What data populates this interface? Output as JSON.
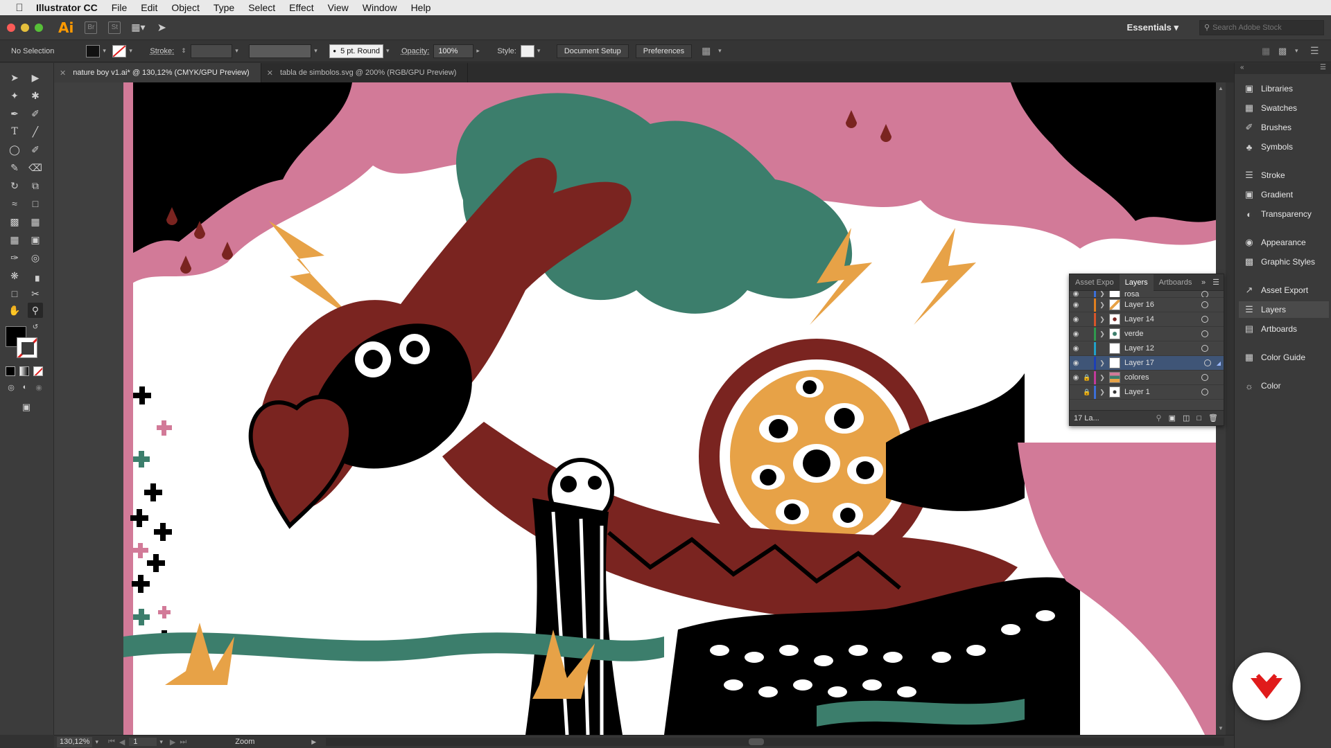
{
  "menubar": {
    "app_name": "Illustrator CC",
    "items": [
      "File",
      "Edit",
      "Object",
      "Type",
      "Select",
      "Effect",
      "View",
      "Window",
      "Help"
    ]
  },
  "appbar": {
    "logo": "Ai",
    "bridge_icon": "Br",
    "stock_icon": "St",
    "workspace": "Essentials",
    "search_placeholder": "Search Adobe Stock"
  },
  "controlbar": {
    "selection": "No Selection",
    "stroke_label": "Stroke:",
    "brush": "5 pt. Round",
    "opacity_label": "Opacity:",
    "opacity": "100%",
    "style_label": "Style:",
    "document_setup": "Document Setup",
    "preferences": "Preferences"
  },
  "tabs": [
    {
      "label": "nature boy v1.ai* @ 130,12% (CMYK/GPU Preview)",
      "active": true
    },
    {
      "label": "tabla de simbolos.svg @ 200% (RGB/GPU Preview)",
      "active": false
    }
  ],
  "dock": {
    "items": [
      {
        "label": "Libraries",
        "icon": "libraries-icon"
      },
      {
        "label": "Swatches",
        "icon": "swatches-icon"
      },
      {
        "label": "Brushes",
        "icon": "brushes-icon"
      },
      {
        "label": "Symbols",
        "icon": "symbols-icon"
      },
      {
        "label": "Stroke",
        "icon": "stroke-icon"
      },
      {
        "label": "Gradient",
        "icon": "gradient-icon"
      },
      {
        "label": "Transparency",
        "icon": "transparency-icon"
      },
      {
        "label": "Appearance",
        "icon": "appearance-icon"
      },
      {
        "label": "Graphic Styles",
        "icon": "graphic-styles-icon"
      },
      {
        "label": "Asset Export",
        "icon": "asset-export-icon"
      },
      {
        "label": "Layers",
        "icon": "layers-icon"
      },
      {
        "label": "Artboards",
        "icon": "artboards-icon"
      },
      {
        "label": "Color Guide",
        "icon": "color-guide-icon"
      },
      {
        "label": "Color",
        "icon": "color-icon"
      }
    ]
  },
  "layers_panel": {
    "tabs": [
      "Asset Expo",
      "Layers",
      "Artboards"
    ],
    "active_tab": "Layers",
    "rows": [
      {
        "name": "rosa",
        "color": "#3c6fd8",
        "visible": true,
        "locked": false
      },
      {
        "name": "Layer 16",
        "color": "#e0801e",
        "visible": true,
        "locked": false
      },
      {
        "name": "Layer 14",
        "color": "#d8552a",
        "visible": true,
        "locked": false
      },
      {
        "name": "verde",
        "color": "#2f9a4e",
        "visible": true,
        "locked": false
      },
      {
        "name": "Layer 12",
        "color": "#21a0c8",
        "visible": true,
        "locked": false
      },
      {
        "name": "Layer 17",
        "color": "#1c3fb8",
        "visible": true,
        "locked": false,
        "selected": true
      },
      {
        "name": "colores",
        "color": "#c23a9a",
        "visible": true,
        "locked": true
      },
      {
        "name": "Layer 1",
        "color": "#3c6fd8",
        "visible": false,
        "locked": true
      }
    ],
    "count": "17 La..."
  },
  "statusbar": {
    "zoom": "130,12%",
    "artboard": "1",
    "tool": "Zoom"
  },
  "colors": {
    "pink": "#d27a98",
    "maroon": "#7a2420",
    "teal": "#3c7e6c",
    "orange": "#e7a247",
    "black": "#000000"
  }
}
